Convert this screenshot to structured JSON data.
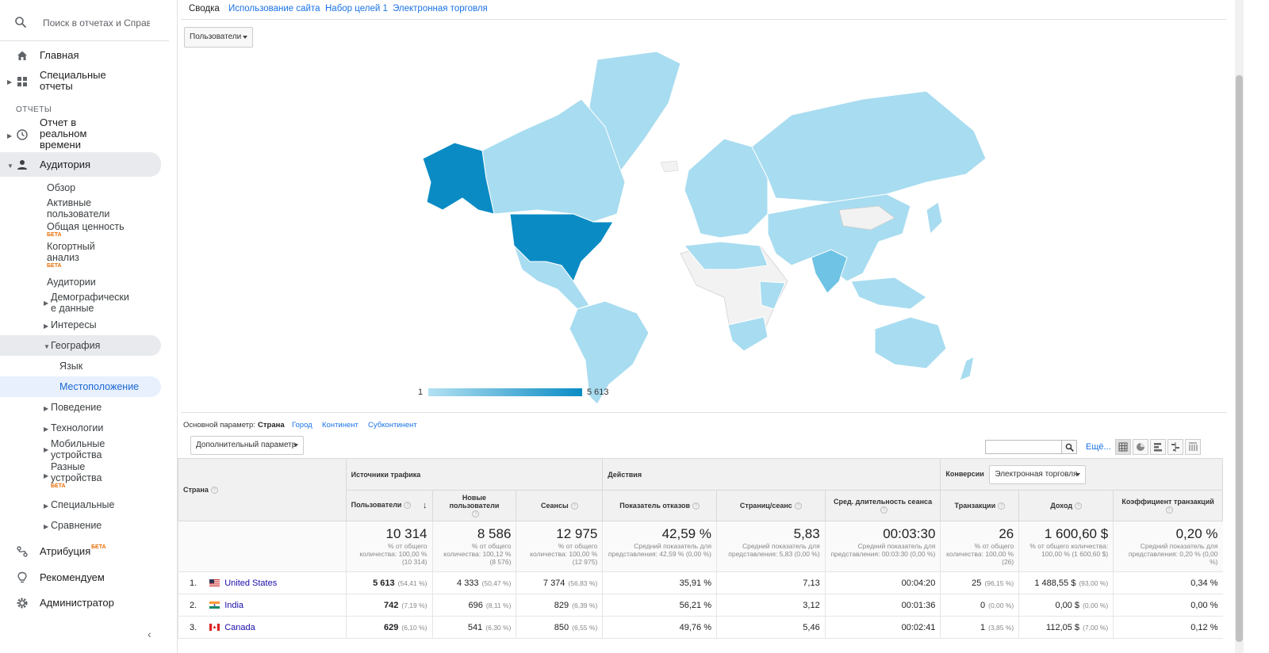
{
  "search": {
    "placeholder": "Поиск в отчетах и Справке"
  },
  "nav": {
    "home": "Главная",
    "custom_reports": "Специальные отчеты",
    "section": "ОТЧЕТЫ",
    "realtime": "Отчет в реальном времени",
    "audience": "Аудитория",
    "overview": "Обзор",
    "active_users": "Активные пользователи",
    "lifetime_value": "Общая ценность",
    "cohort": "Когортный анализ",
    "audiences": "Аудитории",
    "demographics": "Демографически е данные",
    "interests": "Интересы",
    "geo": "География",
    "language": "Язык",
    "location": "Местоположение",
    "behavior": "Поведение",
    "technology": "Технологии",
    "mobile": "Мобильные устройства",
    "cross_device": "Разные устройства",
    "custom": "Специальные",
    "benchmarking": "Сравнение",
    "attribution": "Атрибуция",
    "beta": "БЕТА",
    "discover": "Рекомендуем",
    "admin": "Администратор"
  },
  "tabs": [
    "Сводка",
    "Использование сайта",
    "Набор целей 1",
    "Электронная торговля"
  ],
  "metric_dropdown": "Пользователи",
  "legend": {
    "min": "1",
    "max": "5 613"
  },
  "dimension": {
    "label": "Основной параметр:",
    "options": [
      "Страна",
      "Город",
      "Континент",
      "Субконтинент"
    ]
  },
  "secondary_dim": "Дополнительный параметр",
  "more_link": "Ещё...",
  "table": {
    "country_header": "Страна",
    "groups": {
      "acquisition": "Источники трафика",
      "behavior": "Действия",
      "conversions": "Конверсии"
    },
    "conversion_dropdown": "Электронная торговля",
    "columns": [
      "Пользователи",
      "Новые пользователи",
      "Сеансы",
      "Показатель отказов",
      "Страниц/сеанс",
      "Сред. длительность сеанса",
      "Транзакции",
      "Доход",
      "Коэффициент транзакций"
    ],
    "totals": [
      {
        "big": "10 314",
        "sub": "% от общего количества: 100,00 % (10 314)"
      },
      {
        "big": "8 586",
        "sub": "% от общего количества: 100,12 % (8 576)"
      },
      {
        "big": "12 975",
        "sub": "% от общего количества: 100,00 % (12 975)"
      },
      {
        "big": "42,59 %",
        "sub": "Средний показатель для представления: 42,59 % (0,00 %)"
      },
      {
        "big": "5,83",
        "sub": "Средний показатель для представления: 5,83 (0,00 %)"
      },
      {
        "big": "00:03:30",
        "sub": "Средний показатель для представления: 00:03:30 (0,00 %)"
      },
      {
        "big": "26",
        "sub": "% от общего количества: 100,00 % (26)"
      },
      {
        "big": "1 600,60 $",
        "sub": "% от общего количества: 100,00 % (1 600,60 $)"
      },
      {
        "big": "0,20 %",
        "sub": "Средний показатель для представления: 0,20 % (0,00 %)"
      }
    ],
    "rows": [
      {
        "idx": "1.",
        "country": "United States",
        "users": "5 613",
        "users_pct": "(54,41 %)",
        "new": "4 333",
        "new_pct": "(50,47 %)",
        "sessions": "7 374",
        "sessions_pct": "(56,83 %)",
        "bounce": "35,91 %",
        "pages": "7,13",
        "duration": "00:04:20",
        "tx": "25",
        "tx_pct": "(96,15 %)",
        "revenue": "1 488,55 $",
        "rev_pct": "(93,00 %)",
        "rate": "0,34 %"
      },
      {
        "idx": "2.",
        "country": "India",
        "users": "742",
        "users_pct": "(7,19 %)",
        "new": "696",
        "new_pct": "(8,11 %)",
        "sessions": "829",
        "sessions_pct": "(6,39 %)",
        "bounce": "56,21 %",
        "pages": "3,12",
        "duration": "00:01:36",
        "tx": "0",
        "tx_pct": "(0,00 %)",
        "revenue": "0,00 $",
        "rev_pct": "(0,00 %)",
        "rate": "0,00 %"
      },
      {
        "idx": "3.",
        "country": "Canada",
        "users": "629",
        "users_pct": "(6,10 %)",
        "new": "541",
        "new_pct": "(6,30 %)",
        "sessions": "850",
        "sessions_pct": "(6,55 %)",
        "bounce": "49,76 %",
        "pages": "5,46",
        "duration": "00:02:41",
        "tx": "1",
        "tx_pct": "(3,85 %)",
        "revenue": "112,05 $",
        "rev_pct": "(7,00 %)",
        "rate": "0,12 %"
      }
    ]
  },
  "colors": {
    "accent": "#1a73e8",
    "map_light": "#a8dcf0",
    "map_dark": "#0a8bc4",
    "map_none": "#f2f2f2"
  }
}
